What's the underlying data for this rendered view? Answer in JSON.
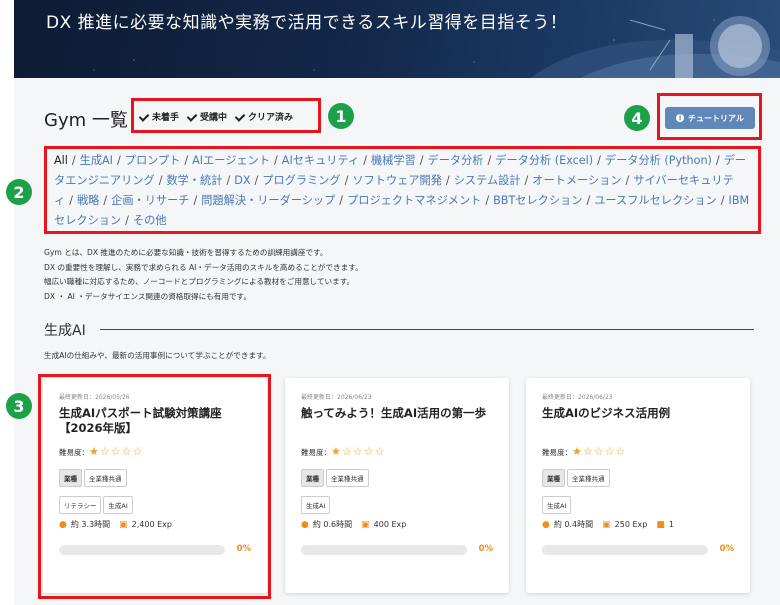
{
  "hero": {
    "heading": "DX 推進に必要な知識や実務で活用できるスキル習得を目指そう！"
  },
  "gym": {
    "title": "Gym 一覧",
    "filters": [
      {
        "label": "未着手",
        "checked": true
      },
      {
        "label": "受講中",
        "checked": true
      },
      {
        "label": "クリア済み",
        "checked": true
      }
    ],
    "tutorial_label": "チュートリアル"
  },
  "annotations": {
    "n1": "1",
    "n2": "2",
    "n3": "3",
    "n4": "4"
  },
  "categories": [
    "All",
    "生成AI",
    "プロンプト",
    "AIエージェント",
    "AIセキュリティ",
    "機械学習",
    "データ分析",
    "データ分析 (Excel)",
    "データ分析 (Python)",
    "データエンジニアリング",
    "数学・統計",
    "DX",
    "プログラミング",
    "ソフトウェア開発",
    "システム設計",
    "オートメーション",
    "サイバーセキュリティ",
    "戦略",
    "企画・リサーチ",
    "問題解決・リーダーシップ",
    "プロジェクトマネジメント",
    "BBTセレクション",
    "ユースフルセレクション",
    "IBMセレクション",
    "その他"
  ],
  "intro": [
    "Gym とは、DX 推進のために必要な知識・技術を習得するための訓練用講座です。",
    "DX の重要性を理解し、実務で求められる AI・データ活用のスキルを高めることができます。",
    "幅広い職種に対応するため、ノーコードとプログラミングによる教材をご用意しています。",
    "DX ・ AI ・データサイエンス関連の資格取得にも有用です。"
  ],
  "section": {
    "title": "生成AI",
    "description": "生成AIの仕組みや、最新の活用事例について学ぶことができます。"
  },
  "cards": [
    {
      "updated": "最終更新日：2026/05/26",
      "title": "生成AIパスポート試験対策講座【2026年版】",
      "difficulty_label": "難易度：",
      "stars": "★☆☆☆☆",
      "difficulty": 1,
      "industry_label": "業種",
      "industry": "全業種共通",
      "tags": [
        "リテラシー",
        "生成AI"
      ],
      "time": "約 3.3時間",
      "exp": "2,400 Exp",
      "comments": "",
      "progress": "0%"
    },
    {
      "updated": "最終更新日：2026/06/23",
      "title": "触ってみよう！生成AI活用の第一歩",
      "difficulty_label": "難易度：",
      "stars": "★☆☆☆☆",
      "difficulty": 1,
      "industry_label": "業種",
      "industry": "全業種共通",
      "tags": [
        "生成AI"
      ],
      "time": "約 0.6時間",
      "exp": "400 Exp",
      "comments": "",
      "progress": "0%"
    },
    {
      "updated": "最終更新日：2026/06/23",
      "title": "生成AIのビジネス活用例",
      "difficulty_label": "難易度：",
      "stars": "★☆☆☆☆",
      "difficulty": 1,
      "industry_label": "業種",
      "industry": "全業種共通",
      "tags": [
        "生成AI"
      ],
      "time": "約 0.4時間",
      "exp": "250 Exp",
      "comments": "1",
      "progress": "0%"
    }
  ],
  "colors": {
    "annotation_red": "#e8141b",
    "badge_green": "#1ea04b",
    "link_blue": "#4a78b8",
    "accent_orange": "#f28c18",
    "tutorial_button": "#5f87b8"
  }
}
